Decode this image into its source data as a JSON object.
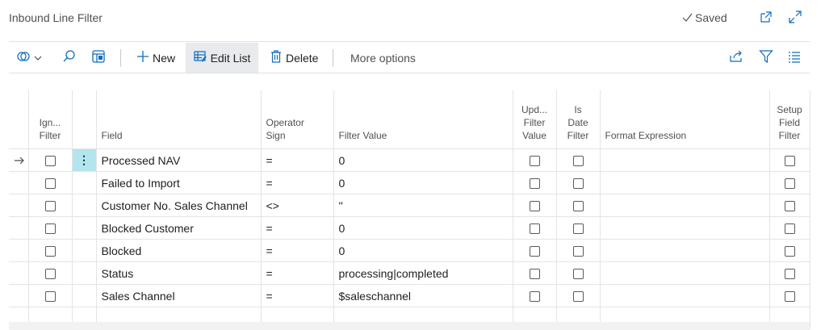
{
  "page": {
    "title": "Inbound Line Filter",
    "status": "Saved"
  },
  "icons": {
    "saved": "check-icon",
    "open_new_window": "open-new-window-icon",
    "expand": "expand-icon",
    "views": "views-icon",
    "search": "search-icon",
    "open_in_excel": "table-view-icon",
    "new": "plus-icon",
    "edit_list": "edit-list-icon",
    "delete": "trash-icon",
    "share": "share-icon",
    "filter": "filter-icon",
    "list_layout": "list-layout-icon"
  },
  "toolbar": {
    "new_label": "New",
    "edit_list_label": "Edit List",
    "delete_label": "Delete",
    "more_options_label": "More options"
  },
  "columns": {
    "ignore_filter": [
      "Ign...",
      "Filter"
    ],
    "field": "Field",
    "operator_sign": [
      "Operator",
      "Sign"
    ],
    "filter_value": "Filter Value",
    "update_filter_value": [
      "Upd...",
      "Filter",
      "Value"
    ],
    "is_date_filter": [
      "Is",
      "Date",
      "Filter"
    ],
    "format_expression": "Format Expression",
    "setup_field_filter": [
      "Setup",
      "Field",
      "Filter"
    ]
  },
  "rows": [
    {
      "field": "Processed NAV",
      "operator": "=",
      "filter_value": "0",
      "selected": true
    },
    {
      "field": "Failed to Import",
      "operator": "=",
      "filter_value": "0"
    },
    {
      "field": "Customer No. Sales Channel",
      "operator": "<>",
      "filter_value": "''"
    },
    {
      "field": "Blocked Customer",
      "operator": "=",
      "filter_value": "0"
    },
    {
      "field": "Blocked",
      "operator": "=",
      "filter_value": "0"
    },
    {
      "field": "Status",
      "operator": "=",
      "filter_value": "processing|completed"
    },
    {
      "field": "Sales Channel",
      "operator": "=",
      "filter_value": "$saleschannel"
    }
  ],
  "colors": {
    "accent": "#0f6cbd",
    "row_selector": "#b3e5ee",
    "text": "#212121",
    "muted": "#505050"
  }
}
